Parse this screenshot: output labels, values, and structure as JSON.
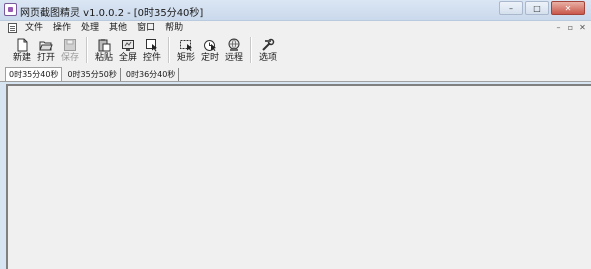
{
  "window": {
    "app_name": "网页截图精灵 v1.0.0.2",
    "separator": "-",
    "doc_title": "[0时35分40秒]",
    "min_glyph": "–",
    "max_glyph": "□",
    "close_glyph": "✕"
  },
  "menu": {
    "items": [
      "文件",
      "操作",
      "处理",
      "其他",
      "窗口",
      "帮助"
    ],
    "mdi": {
      "minimize": "–",
      "restore": "▫",
      "close": "✕"
    }
  },
  "toolbar": {
    "groups": [
      [
        {
          "label": "新建",
          "icon": "new-icon",
          "enabled": true
        },
        {
          "label": "打开",
          "icon": "open-icon",
          "enabled": true
        },
        {
          "label": "保存",
          "icon": "save-icon",
          "enabled": false
        }
      ],
      [
        {
          "label": "粘贴",
          "icon": "paste-icon",
          "enabled": true
        },
        {
          "label": "全屏",
          "icon": "fullscreen-icon",
          "enabled": true
        },
        {
          "label": "控件",
          "icon": "control-icon",
          "enabled": true
        }
      ],
      [
        {
          "label": "矩形",
          "icon": "rectangle-icon",
          "enabled": true
        },
        {
          "label": "定时",
          "icon": "timer-icon",
          "enabled": true
        },
        {
          "label": "远程",
          "icon": "remote-icon",
          "enabled": true
        }
      ],
      [
        {
          "label": "选项",
          "icon": "options-icon",
          "enabled": true
        }
      ]
    ]
  },
  "tabs": {
    "items": [
      "0时35分40秒",
      "0时35分50秒",
      "0时36分40秒"
    ],
    "active": 0
  },
  "colors": {
    "accent": "#9b59b6",
    "titlebar": "#cad9ec",
    "close": "#c9574a"
  }
}
